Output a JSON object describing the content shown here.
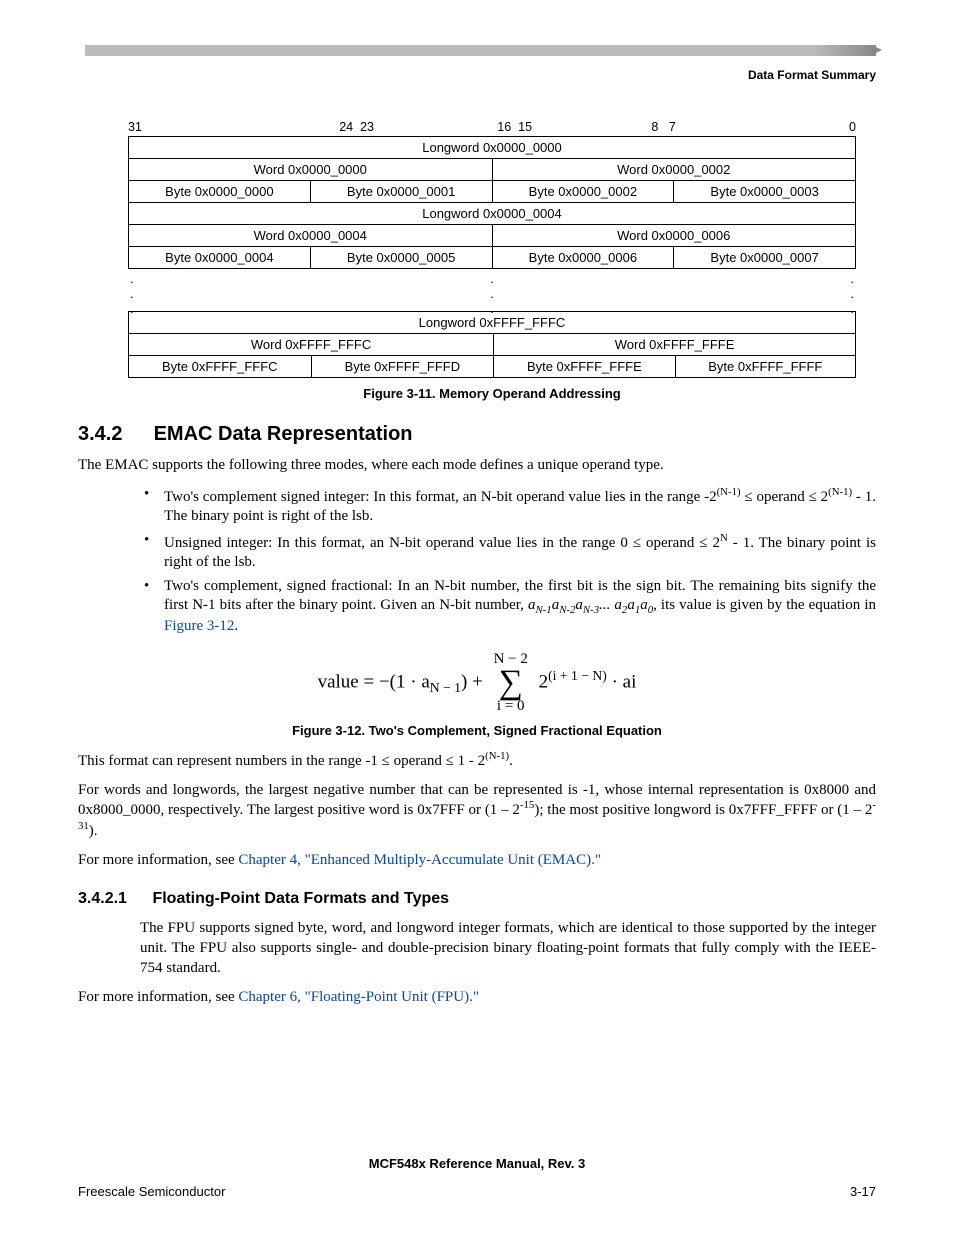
{
  "header": {
    "section": "Data Format Summary"
  },
  "bitlabels": {
    "b31": "31",
    "b24": "24",
    "b23": "23",
    "b16": "16",
    "b15": "15",
    "b8": "8",
    "b7": "7",
    "b0": "0"
  },
  "table1": {
    "long0": "Longword 0x0000_0000",
    "word00": "Word 0x0000_0000",
    "word02": "Word 0x0000_0002",
    "b00": "Byte 0x0000_0000",
    "b01": "Byte 0x0000_0001",
    "b02": "Byte 0x0000_0002",
    "b03": "Byte 0x0000_0003",
    "long4": "Longword 0x0000_0004",
    "word04": "Word 0x0000_0004",
    "word06": "Word 0x0000_0006",
    "b04": "Byte 0x0000_0004",
    "b05": "Byte 0x0000_0005",
    "b06": "Byte 0x0000_0006",
    "b07": "Byte 0x0000_0007",
    "longF": "Longword 0xFFFF_FFFC",
    "wordFC": "Word 0xFFFF_FFFC",
    "wordFE": "Word 0xFFFF_FFFE",
    "bFC": "Byte 0xFFFF_FFFC",
    "bFD": "Byte 0xFFFF_FFFD",
    "bFE": "Byte 0xFFFF_FFFE",
    "bFF": "Byte 0xFFFF_FFFF"
  },
  "fig311": "Figure 3-11. Memory Operand Addressing",
  "sec342": {
    "num": "3.4.2",
    "title": "EMAC Data Representation"
  },
  "p1": "The EMAC supports the following three modes, where each mode defines a unique operand type.",
  "bullet1a": "Two's complement signed integer: In this format, an N-bit operand value lies in the range -2",
  "bullet1b": " ≤ operand ≤ 2",
  "bullet1c": " - 1. The binary point is right of the lsb.",
  "bullet2a": "Unsigned integer: In this format, an N-bit operand value lies in the range 0 ≤ operand ≤ 2",
  "bullet2b": " - 1. The binary point is right of the lsb.",
  "bullet3a": "Two's complement, signed fractional: In an N-bit number, the first bit is the sign bit. The remaining bits signify the first N-1 bits after the binary point. Given an N-bit number, ",
  "bullet3b": ", its value is given by the equation in ",
  "link312": "Figure 3-12",
  "eq": {
    "lhs": "value = −(1 · a",
    "sub_nm1": "N − 1",
    "plus": ") + ",
    "sum_top": "N − 2",
    "sum_bot": "i = 0",
    "term_a": "2",
    "exp": "(i + 1 − N)",
    "term_b": " · ai"
  },
  "fig312": "Figure 3-12. Two's Complement, Signed Fractional Equation",
  "p2a": "This format can represent numbers in the range -1 ≤ operand ≤ 1 - 2",
  "p2b": ".",
  "p3a": "For words and longwords, the largest negative number that can be represented is -1, whose internal representation is 0x8000 and 0x8000_0000, respectively. The largest positive word is 0x7FFF or (1 – 2",
  "p3b": "); the most positive longword is 0x7FFF_FFFF or (1 – 2",
  "p3c": ").",
  "p4a": "For more information, see ",
  "link_ch4": "Chapter 4, \"Enhanced Multiply-Accumulate Unit (EMAC).\"",
  "sec3421": {
    "num": "3.4.2.1",
    "title": "Floating-Point Data Formats and Types"
  },
  "p5": "The FPU supports signed byte, word, and longword integer formats, which are identical to those supported by the integer unit. The FPU also supports single- and double-precision binary floating-point formats that fully comply with the IEEE-754 standard.",
  "p6a": "For more information, see ",
  "link_ch6": "Chapter 6, \"Floating-Point Unit (FPU).\"",
  "footer": {
    "center": "MCF548x Reference Manual, Rev. 3",
    "left": "Freescale Semiconductor",
    "right": "3-17"
  },
  "sup": {
    "nm1": "(N-1)",
    "n": "N",
    "m15": "-15",
    "m31": "-31"
  },
  "ital": {
    "seq1": "a",
    "sN1": "N-1",
    "sN2": "N-2",
    "sN3": "N-3",
    "s2": "2",
    "s1": "1",
    "s0": "0",
    "dots": "... "
  }
}
